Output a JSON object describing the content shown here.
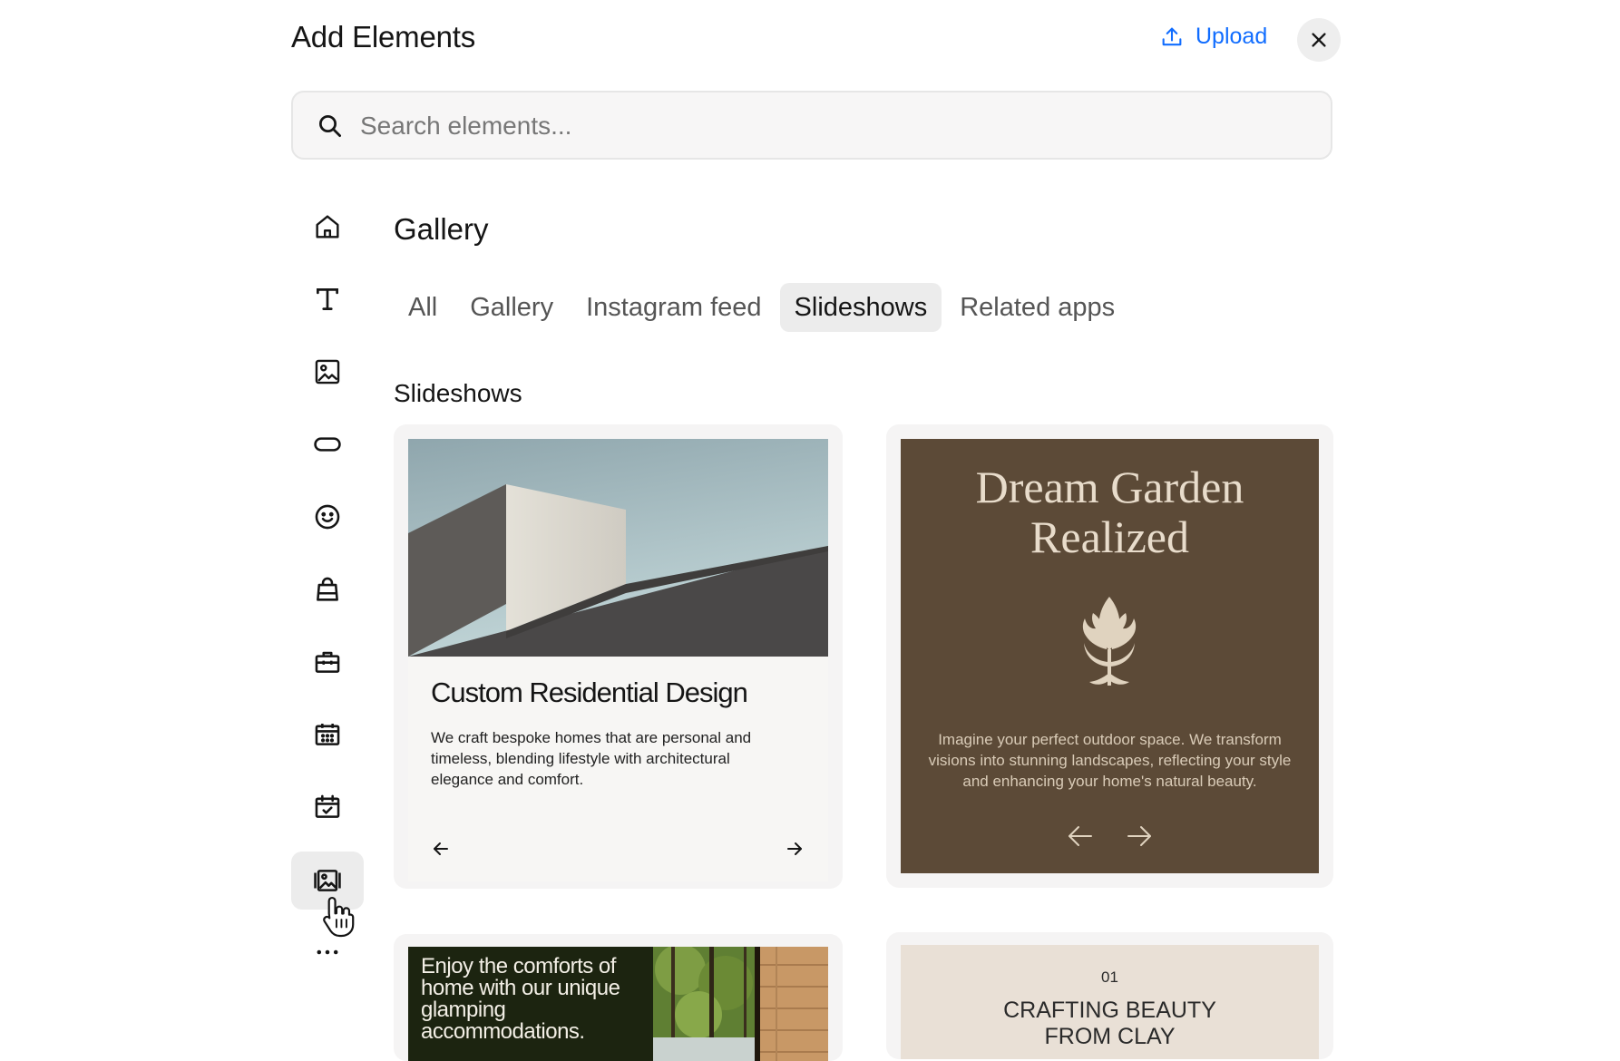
{
  "header": {
    "title": "Add Elements",
    "upload_label": "Upload"
  },
  "search": {
    "placeholder": "Search elements..."
  },
  "sidebar": {
    "items": [
      {
        "icon": "home-icon"
      },
      {
        "icon": "text-icon"
      },
      {
        "icon": "image-icon"
      },
      {
        "icon": "button-shape-icon"
      },
      {
        "icon": "smiley-icon"
      },
      {
        "icon": "shopping-bag-icon"
      },
      {
        "icon": "briefcase-icon"
      },
      {
        "icon": "calendar-grid-icon"
      },
      {
        "icon": "calendar-check-icon"
      },
      {
        "icon": "gallery-icon",
        "active": true
      },
      {
        "icon": "more-icon"
      }
    ]
  },
  "main": {
    "section_title": "Gallery",
    "tabs": [
      {
        "label": "All"
      },
      {
        "label": "Gallery"
      },
      {
        "label": "Instagram feed"
      },
      {
        "label": "Slideshows",
        "active": true
      },
      {
        "label": "Related apps"
      }
    ],
    "subsection_title": "Slideshows",
    "cards": [
      {
        "heading": "Custom Residential Design",
        "body": "We craft bespoke homes that are personal and timeless, blending lifestyle with architectural elegance and comfort."
      },
      {
        "heading_line1": "Dream Garden",
        "heading_line2": "Realized",
        "body": "Imagine your perfect outdoor space. We transform visions into stunning landscapes, reflecting your style and enhancing your home's natural beauty."
      },
      {
        "text": "Enjoy the comforts of home with our unique glamping accommodations."
      },
      {
        "number": "01",
        "heading_line1": "CRAFTING BEAUTY",
        "heading_line2": "FROM CLAY"
      }
    ]
  },
  "colors": {
    "accent": "#116dff",
    "garden_card_bg": "#5c4a37",
    "glamping_card_bg": "#1c2410",
    "clay_card_bg": "#e9e0d6"
  }
}
